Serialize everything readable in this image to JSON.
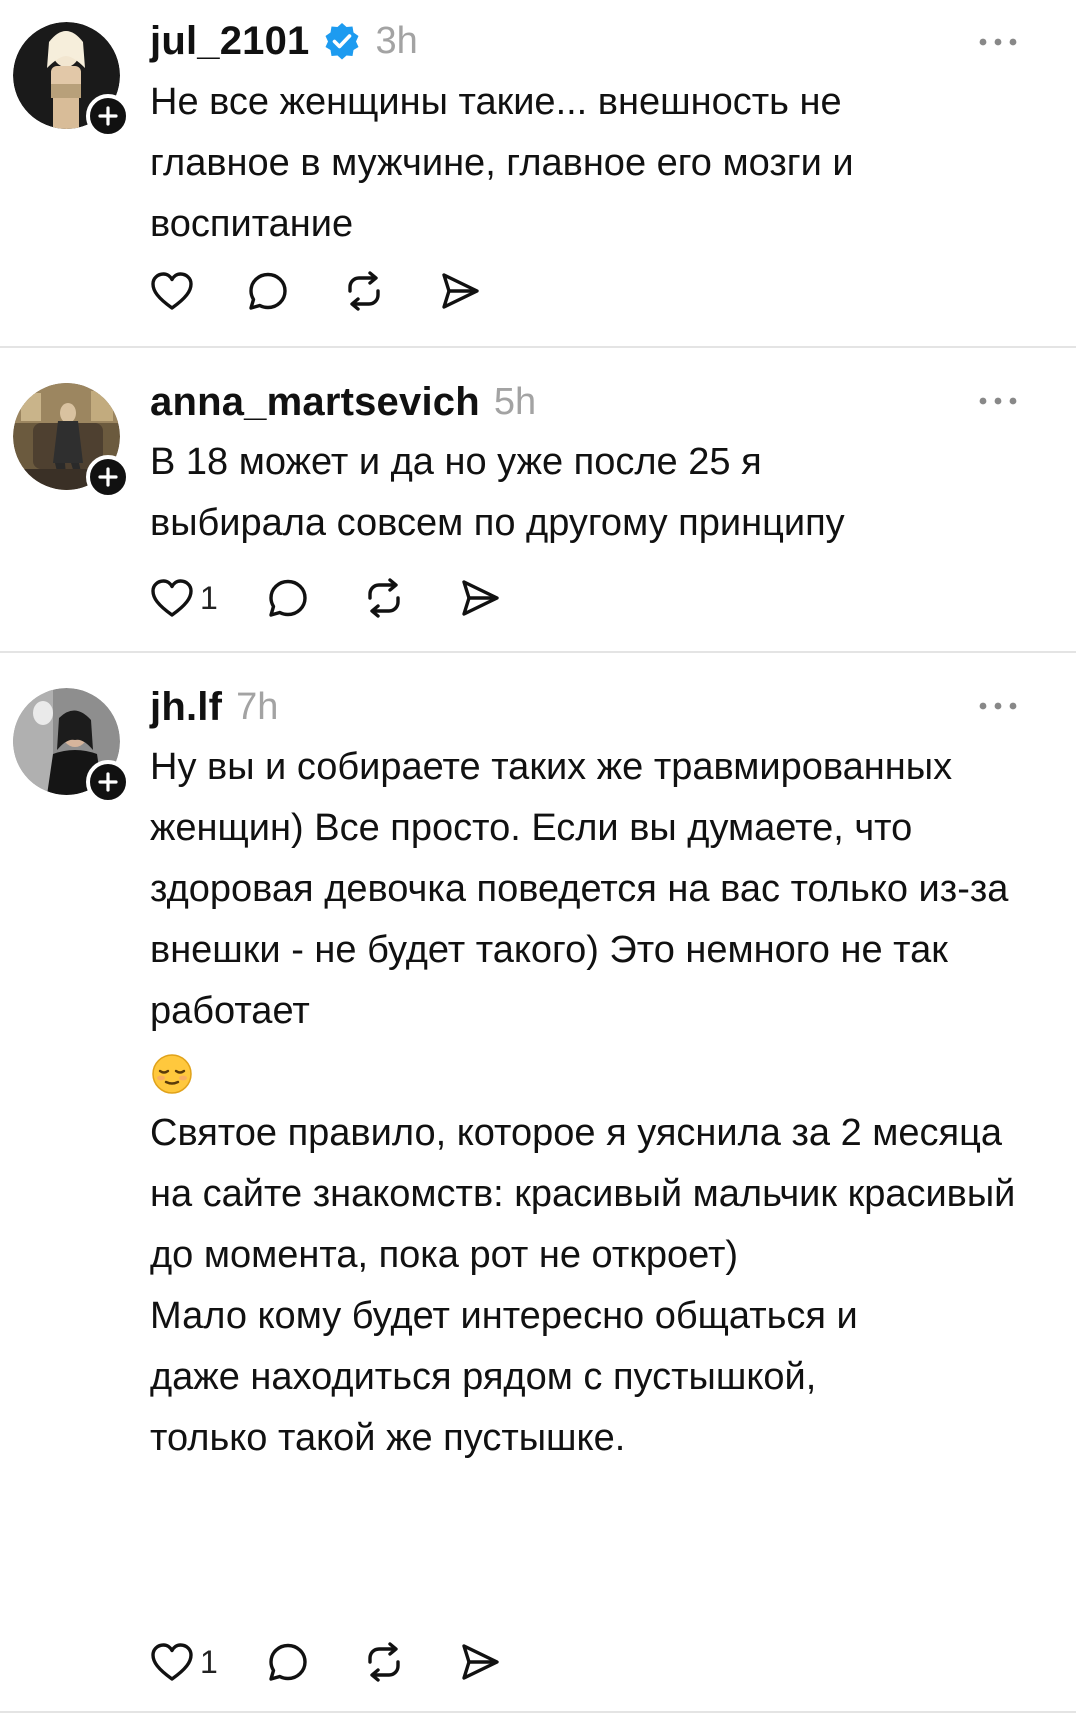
{
  "posts": [
    {
      "username": "jul_2101",
      "verified": true,
      "time": "3h",
      "lines": [
        "Не все женщины такие... внешность не главное в мужчине, главное его мозги и воспитание"
      ],
      "likes": "",
      "icons": {
        "avatar": "avatar-photo",
        "follow": "plus-icon",
        "more": "more-icon",
        "like": "heart-icon",
        "reply": "comment-icon",
        "repost": "repost-icon",
        "share": "send-icon"
      }
    },
    {
      "username": "anna_martsevich",
      "verified": false,
      "time": "5h",
      "lines": [
        "В 18 может и да но уже после 25 я выбирала совсем по другому принципу"
      ],
      "likes": "1"
    },
    {
      "username": "jh.lf",
      "verified": false,
      "time": "7h",
      "lines": [
        "Ну вы и собираете таких же травмированных женщин) Все просто. Если вы думаете, что здоровая девочка поведется на вас только из-за внешки - не будет такого) Это немного не так работает",
        "Святое правило, которое я уяснила за 2 месяца на сайте знакомств: красивый мальчик красивый до момента, пока рот не откроет)",
        "Мало кому будет интересно общаться и даже находиться рядом с пустышкой, только такой же пустышке."
      ],
      "emoji": "relieved-face-emoji",
      "likes": "1"
    }
  ],
  "colors": {
    "text": "#111111",
    "muted": "#a3a3a3",
    "verified": "#1d9bf0",
    "divider": "#e4e4e4"
  }
}
